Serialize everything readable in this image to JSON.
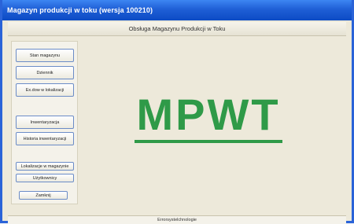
{
  "window": {
    "title": "Magazyn produkcji w toku  (wersja 100210)"
  },
  "header": {
    "title": "Obsługa Magazynu Produkcji w Toku"
  },
  "sidebar": {
    "buttons": [
      {
        "label": "Stan magazynu"
      },
      {
        "label": "Dziennik"
      },
      {
        "label": "Ex.dow w lokalizacji"
      },
      {
        "label": "Inwentaryzacja"
      },
      {
        "label": "Historia inwentaryzacji"
      },
      {
        "label": "Lokalizacje w magazynie"
      },
      {
        "label": "Użytkownicy"
      },
      {
        "label": "Zamknij"
      }
    ]
  },
  "main": {
    "logo_text": "MPWT"
  },
  "status_bar": {
    "text": "Errorsystelchnologie"
  },
  "colors": {
    "titlebar": "#1f5fd6",
    "logo": "#2f9a48",
    "background": "#ede9da"
  }
}
